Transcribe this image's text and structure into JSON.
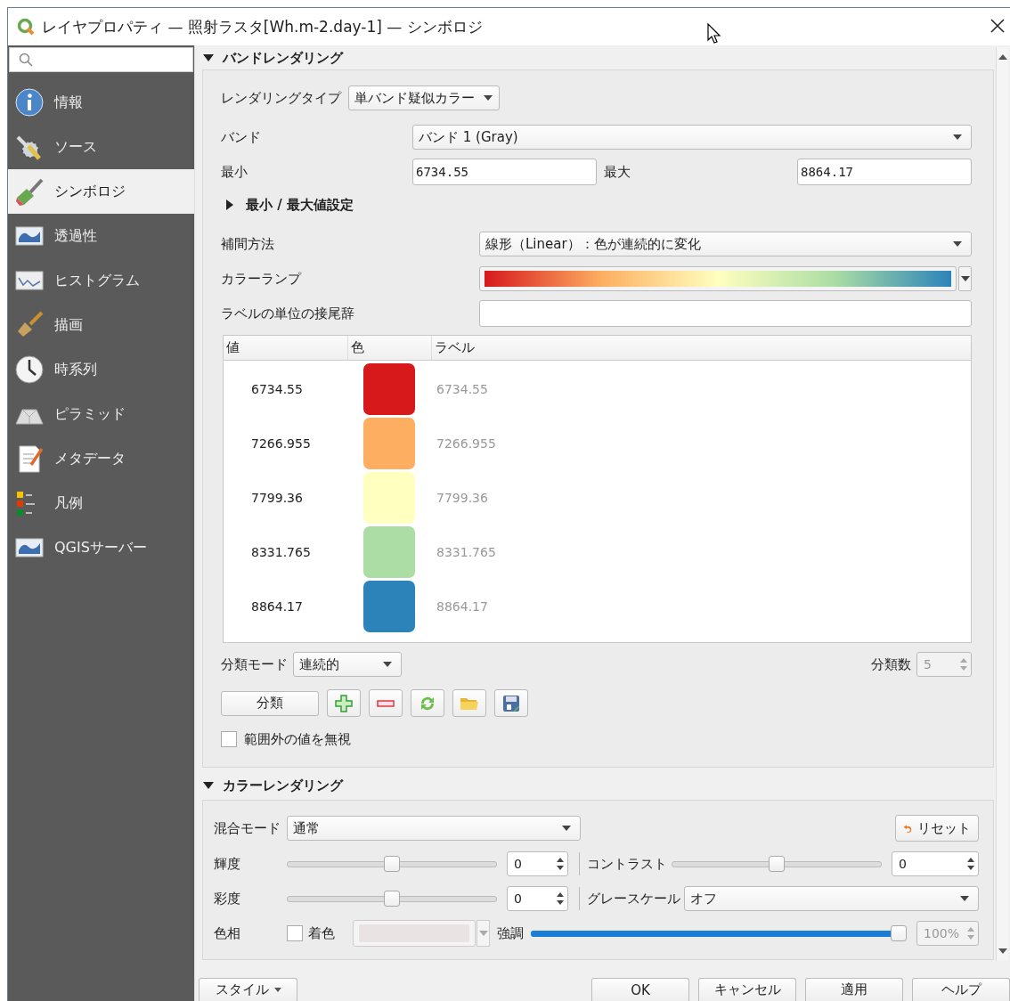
{
  "window": {
    "title": "レイヤプロパティ — 照射ラスタ[Wh.m-2.day-1] — シンボロジ"
  },
  "sidebar": {
    "items": [
      {
        "label": "情報",
        "selected": false
      },
      {
        "label": "ソース",
        "selected": false
      },
      {
        "label": "シンボロジ",
        "selected": true
      },
      {
        "label": "透過性",
        "selected": false
      },
      {
        "label": "ヒストグラム",
        "selected": false
      },
      {
        "label": "描画",
        "selected": false
      },
      {
        "label": "時系列",
        "selected": false
      },
      {
        "label": "ピラミッド",
        "selected": false
      },
      {
        "label": "メタデータ",
        "selected": false
      },
      {
        "label": "凡例",
        "selected": false
      },
      {
        "label": "QGISサーバー",
        "selected": false
      }
    ]
  },
  "band_rendering": {
    "title": "バンドレンダリング",
    "expanded": true,
    "render_type": {
      "label": "レンダリングタイプ",
      "value": "単バンド疑似カラー"
    },
    "band": {
      "label": "バンド",
      "value": "バンド 1 (Gray)"
    },
    "min": {
      "label": "最小",
      "value": "6734.55"
    },
    "max": {
      "label": "最大",
      "value": "8864.17"
    },
    "minmax_settings": {
      "title": "最小 / 最大値設定",
      "expanded": false
    },
    "interpolation": {
      "label": "補間方法",
      "value": "線形（Linear）：色が連続的に変化"
    },
    "color_ramp": {
      "label": "カラーランプ"
    },
    "label_suffix": {
      "label": "ラベルの単位の接尾辞"
    },
    "table": {
      "columns": [
        "値",
        "色",
        "ラベル"
      ],
      "rows": [
        {
          "value": "6734.55",
          "color": "#d7191c",
          "label": "6734.55"
        },
        {
          "value": "7266.955",
          "color": "#fdae61",
          "label": "7266.955"
        },
        {
          "value": "7799.36",
          "color": "#ffffbf",
          "label": "7799.36"
        },
        {
          "value": "8331.765",
          "color": "#abdda4",
          "label": "8331.765"
        },
        {
          "value": "8864.17",
          "color": "#2b83ba",
          "label": "8864.17"
        }
      ]
    },
    "mode": {
      "label": "分類モード",
      "value": "連続的"
    },
    "classes": {
      "label": "分類数",
      "value": "5",
      "disabled": true
    },
    "classify_button": "分類",
    "ignore_out_of_range": {
      "label": "範囲外の値を無視",
      "checked": false
    }
  },
  "color_rendering": {
    "title": "カラーレンダリング",
    "expanded": true,
    "blend_mode": {
      "label": "混合モード",
      "value": "通常"
    },
    "reset_button": "リセット",
    "brightness": {
      "label": "輝度",
      "level": 0.5,
      "value": "0"
    },
    "contrast": {
      "label": "コントラスト",
      "level": 0.5,
      "value": "0"
    },
    "saturation": {
      "label": "彩度",
      "level": 0.5,
      "value": "0"
    },
    "grayscale": {
      "label": "グレースケール",
      "value": "オフ"
    },
    "hue": {
      "label": "色相"
    },
    "colorize": {
      "label": "着色",
      "checked": false
    },
    "strength": {
      "label": "強調",
      "level": 1,
      "value": "100%",
      "disabled": true
    }
  },
  "footer": {
    "style_button": "スタイル",
    "buttons": [
      "OK",
      "キャンセル",
      "適用",
      "ヘルプ"
    ]
  }
}
